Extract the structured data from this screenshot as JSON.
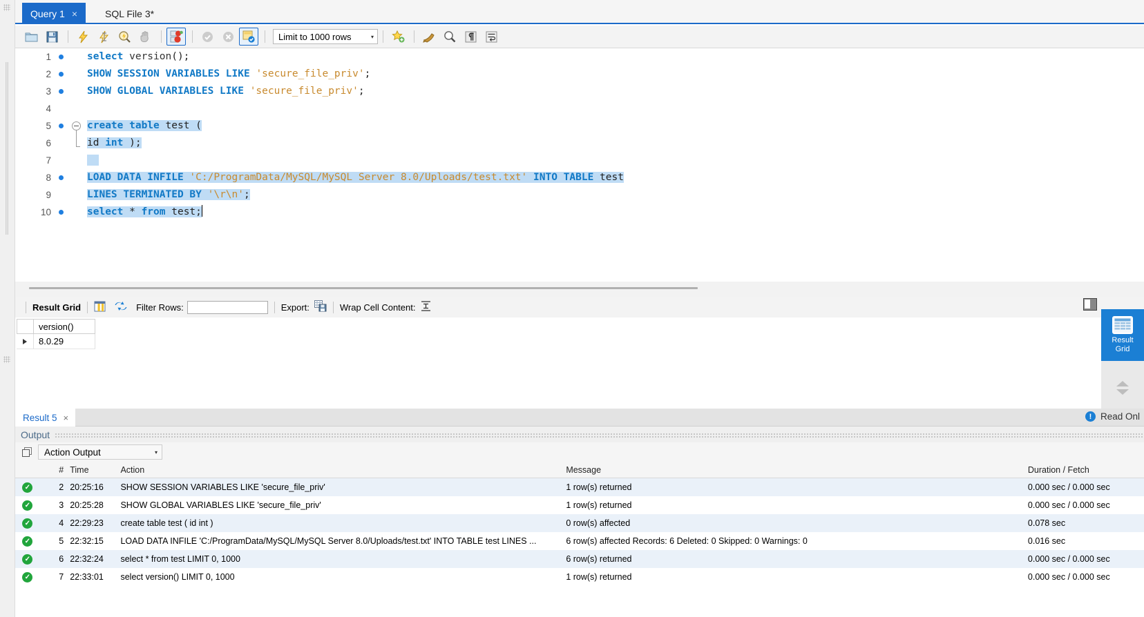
{
  "window": {
    "tabs": [
      {
        "label": "Query 1",
        "active": true,
        "close": "×"
      },
      {
        "label": "SQL File 3*",
        "active": false,
        "close": ""
      }
    ]
  },
  "toolbar": {
    "buttons": [
      {
        "name": "open-sql-script-icon",
        "glyph": "folder"
      },
      {
        "name": "save-sql-script-icon",
        "glyph": "floppy"
      },
      {
        "name": "execute-statement-icon",
        "glyph": "bolt"
      },
      {
        "name": "execute-current-statement-icon",
        "glyph": "bolt-cursor"
      },
      {
        "name": "explain-statement-icon",
        "glyph": "magnifier-bolt"
      },
      {
        "name": "stop-script-icon",
        "glyph": "hand"
      },
      {
        "name": "toggle-stop-on-error-icon",
        "glyph": "stop-error",
        "framed": true
      },
      {
        "name": "commit-icon",
        "glyph": "check-gray"
      },
      {
        "name": "rollback-icon",
        "glyph": "cross-gray"
      },
      {
        "name": "toggle-autocommit-icon",
        "glyph": "autocommit",
        "framed": true
      }
    ],
    "limit_label": "Limit to 1000 rows",
    "limit_caret": "▾",
    "right_buttons": [
      {
        "name": "save-snippet-icon",
        "glyph": "star-plus"
      },
      {
        "name": "beautify-query-icon",
        "glyph": "broom"
      },
      {
        "name": "find-icon",
        "glyph": "magnifier"
      },
      {
        "name": "toggle-invisible-chars-icon",
        "glyph": "pilcrow"
      },
      {
        "name": "toggle-wrapping-icon",
        "glyph": "wrap"
      }
    ]
  },
  "editor": {
    "lines": [
      {
        "no": "1",
        "marker": true,
        "tokens": [
          {
            "t": "select ",
            "c": "kw"
          },
          {
            "t": "version",
            "c": "fn"
          },
          {
            "t": "();",
            "c": "plain"
          }
        ]
      },
      {
        "no": "2",
        "marker": true,
        "tokens": [
          {
            "t": "SHOW SESSION VARIABLES LIKE ",
            "c": "kw"
          },
          {
            "t": "'secure_file_priv'",
            "c": "str"
          },
          {
            "t": ";",
            "c": "plain"
          }
        ]
      },
      {
        "no": "3",
        "marker": true,
        "tokens": [
          {
            "t": "SHOW GLOBAL VARIABLES LIKE ",
            "c": "kw"
          },
          {
            "t": "'secure_file_priv'",
            "c": "str"
          },
          {
            "t": ";",
            "c": "plain"
          }
        ]
      },
      {
        "no": "4",
        "marker": false,
        "tokens": []
      },
      {
        "no": "5",
        "marker": true,
        "fold": "start",
        "selected": true,
        "tokens": [
          {
            "t": "create table ",
            "c": "kw"
          },
          {
            "t": "test",
            "c": "plain"
          },
          {
            "t": " (",
            "c": "plain"
          }
        ]
      },
      {
        "no": "6",
        "marker": false,
        "fold": "end",
        "selected": true,
        "tokens": [
          {
            "t": "id ",
            "c": "plain"
          },
          {
            "t": "int",
            "c": "kw"
          },
          {
            "t": " );",
            "c": "plain"
          }
        ]
      },
      {
        "no": "7",
        "marker": false,
        "selected": true,
        "tokens": [
          {
            "t": "  ",
            "c": "plain"
          }
        ]
      },
      {
        "no": "8",
        "marker": true,
        "selected": true,
        "tokens": [
          {
            "t": "LOAD DATA INFILE ",
            "c": "kw"
          },
          {
            "t": "'C:/ProgramData/MySQL/MySQL Server 8.0/Uploads/test.txt'",
            "c": "str"
          },
          {
            "t": " INTO TABLE ",
            "c": "kw"
          },
          {
            "t": "test",
            "c": "plain"
          }
        ]
      },
      {
        "no": "9",
        "marker": false,
        "selected": true,
        "tokens": [
          {
            "t": "LINES TERMINATED BY ",
            "c": "kw"
          },
          {
            "t": "'\\r\\n'",
            "c": "str"
          },
          {
            "t": ";",
            "c": "plain"
          }
        ]
      },
      {
        "no": "10",
        "marker": true,
        "selected": true,
        "caret": true,
        "tokens": [
          {
            "t": "select ",
            "c": "kw"
          },
          {
            "t": "* ",
            "c": "plain"
          },
          {
            "t": "from ",
            "c": "kw"
          },
          {
            "t": "test;",
            "c": "plain"
          }
        ]
      }
    ]
  },
  "result_toolbar": {
    "grid_label": "Result Grid",
    "grid_view_icon": "grid-view-icon",
    "refresh_icon": "refresh-icon",
    "filter_label": "Filter Rows:",
    "filter_value": "",
    "filter_placeholder": "",
    "export_label": "Export:",
    "export_icon": "export-icon",
    "wrap_label": "Wrap Cell Content:",
    "wrap_icon": "wrap-cell-icon"
  },
  "result_grid": {
    "columns": [
      "version()"
    ],
    "rows": [
      {
        "marker": "▶",
        "cells": [
          "8.0.29"
        ]
      }
    ]
  },
  "side_panel": {
    "items": [
      {
        "label_line1": "Result",
        "label_line2": "Grid",
        "icon": "result-grid-icon",
        "active": true
      }
    ]
  },
  "result_tabs": {
    "tabs": [
      {
        "label": "Result 5",
        "close": "×"
      }
    ],
    "read_only": "Read Onl",
    "info_icon": "!"
  },
  "output_panel": {
    "title": "Output",
    "selector_value": "Action Output",
    "selector_caret": "▾",
    "copy_icon": "copy-icon",
    "columns": [
      "#",
      "Time",
      "Action",
      "Message",
      "Duration / Fetch"
    ],
    "rows": [
      {
        "status": "ok",
        "num": "2",
        "time": "20:25:16",
        "action": "SHOW SESSION VARIABLES LIKE 'secure_file_priv'",
        "message": "1 row(s) returned",
        "duration": "0.000 sec / 0.000 sec"
      },
      {
        "status": "ok",
        "num": "3",
        "time": "20:25:28",
        "action": "SHOW GLOBAL VARIABLES LIKE 'secure_file_priv'",
        "message": "1 row(s) returned",
        "duration": "0.000 sec / 0.000 sec"
      },
      {
        "status": "ok",
        "num": "4",
        "time": "22:29:23",
        "action": "create table test ( id int )",
        "message": "0 row(s) affected",
        "duration": "0.078 sec"
      },
      {
        "status": "ok",
        "num": "5",
        "time": "22:32:15",
        "action": "LOAD DATA INFILE 'C:/ProgramData/MySQL/MySQL Server 8.0/Uploads/test.txt' INTO TABLE test LINES ...",
        "message": "6 row(s) affected Records: 6  Deleted: 0  Skipped: 0  Warnings: 0",
        "duration": "0.016 sec"
      },
      {
        "status": "ok",
        "num": "6",
        "time": "22:32:24",
        "action": "select * from test LIMIT 0, 1000",
        "message": "6 row(s) returned",
        "duration": "0.000 sec / 0.000 sec"
      },
      {
        "status": "ok",
        "num": "7",
        "time": "22:33:01",
        "action": "select version() LIMIT 0, 1000",
        "message": "1 row(s) returned",
        "duration": "0.000 sec / 0.000 sec"
      }
    ]
  },
  "colors": {
    "accent": "#1b6ac9",
    "panel_blue": "#1b7fd4",
    "selection": "#bfdcf5",
    "keyword": "#1179c6",
    "string": "#c88a2e",
    "ok_green": "#21a53c",
    "row_alt": "#eaf1f9"
  }
}
